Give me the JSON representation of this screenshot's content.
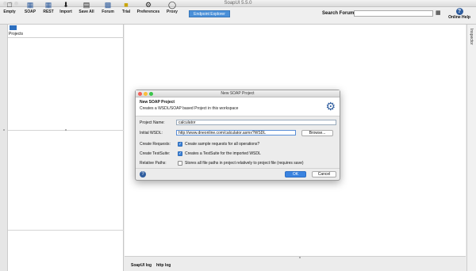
{
  "window": {
    "title": "SoapUI 5.5.0"
  },
  "toolbar": {
    "items": [
      {
        "label": "Empty",
        "icon": "empty-project-icon"
      },
      {
        "label": "SOAP",
        "icon": "soap-icon"
      },
      {
        "label": "REST",
        "icon": "rest-icon"
      },
      {
        "label": "Import",
        "icon": "import-icon"
      },
      {
        "label": "Save All",
        "icon": "save-all-icon"
      },
      {
        "label": "Forum",
        "icon": "forum-icon"
      },
      {
        "label": "Trial",
        "icon": "trial-icon"
      },
      {
        "label": "Preferences",
        "icon": "preferences-icon"
      },
      {
        "label": "Proxy",
        "icon": "proxy-icon"
      }
    ],
    "endpoint_explorer": "Endpoint Explorer",
    "search_label": "Search Forum",
    "search_value": "",
    "online_help": "Online Help",
    "online_help_icon": "?"
  },
  "navigator": {
    "projects_label": "Projects"
  },
  "inspector": {
    "label": "Inspector"
  },
  "logs": {
    "tabs": [
      "SoapUI log",
      "http log"
    ]
  },
  "dialog": {
    "title": "New SOAP Project",
    "heading": "New SOAP Project",
    "subheading": "Creates a WSDL/SOAP based Project in this workspace",
    "project_name_label": "Project Name:",
    "project_name_value": "calculator",
    "wsdl_label": "Initial WSDL:",
    "wsdl_value": "http://www.dneonline.com/calculator.asmx?WSDL",
    "browse_label": "Browse...",
    "create_requests_label": "Create Requests:",
    "create_requests_text": "Create sample requests for all operations?",
    "create_requests_checked": true,
    "create_testsuite_label": "Create TestSuite:",
    "create_testsuite_text": "Creates a TestSuite for the imported WSDL",
    "create_testsuite_checked": true,
    "relative_paths_label": "Relative Paths:",
    "relative_paths_text": "Stores all file paths in project relatively to project file (requires save)",
    "relative_paths_checked": false,
    "ok_label": "OK",
    "cancel_label": "Cancel",
    "help_icon": "?"
  },
  "colors": {
    "accent": "#3a83e0",
    "endpoint_explorer_bg": "#4a90d9",
    "help_blue": "#2f5d9e"
  }
}
